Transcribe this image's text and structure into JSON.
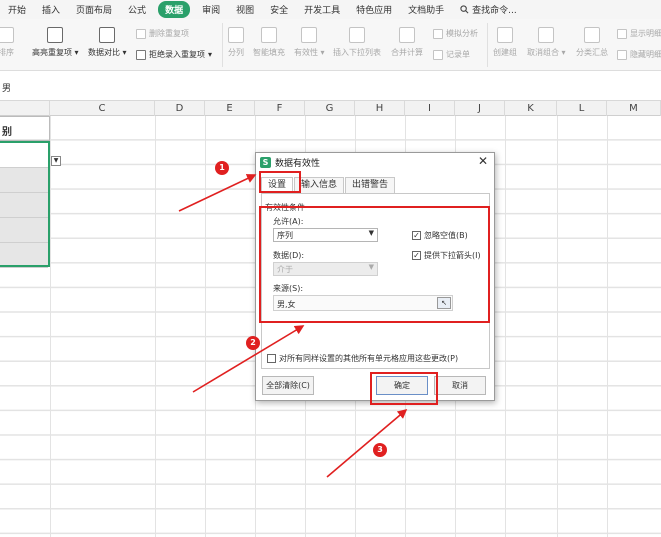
{
  "menubar": {
    "items": [
      "开始",
      "插入",
      "页面布局",
      "公式",
      "数据",
      "审阅",
      "视图",
      "安全",
      "开发工具",
      "特色应用",
      "文档助手"
    ],
    "active": "数据",
    "search": "查找命令..."
  },
  "ribbon": {
    "sort_label": "排序",
    "highlight_dup": "高亮重复项",
    "data_compare": "数据对比",
    "delete_dup": "删除重复项",
    "reject_dup": "拒绝录入重复项",
    "split": "分列",
    "smart_fill": "智能填充",
    "validity": "有效性",
    "insert_dropdown": "插入下拉列表",
    "consolidate": "合并计算",
    "simulate": "模拟分析",
    "record": "记录单",
    "create_group": "创建组",
    "ungroup": "取消组合",
    "subtotal": "分类汇总",
    "show_detail": "显示明细",
    "hide_detail": "隐藏明细"
  },
  "formula_bar": {
    "value": "男"
  },
  "columns": [
    "C",
    "D",
    "E",
    "F",
    "G",
    "H",
    "I",
    "J",
    "K",
    "L",
    "M"
  ],
  "sheet": {
    "b1_text": "别"
  },
  "dialog": {
    "title": "数据有效性",
    "close": "✕",
    "tabs": [
      "设置",
      "输入信息",
      "出错警告"
    ],
    "group_label": "有效性条件",
    "allow_label": "允许(A):",
    "allow_value": "序列",
    "data_label": "数据(D):",
    "data_value": "介于",
    "ignore_blank": "忽略空值(B)",
    "ignore_blank_checked": true,
    "dropdown_arrow": "提供下拉箭头(I)",
    "dropdown_arrow_checked": true,
    "source_label": "来源(S):",
    "source_value": "男,女",
    "apply_all": "对所有同样设置的其他所有单元格应用这些更改(P)",
    "clear_all": "全部清除(C)",
    "ok": "确定",
    "cancel": "取消"
  },
  "annotations": {
    "badge1": "1",
    "badge2": "2",
    "badge3": "3"
  },
  "colors": {
    "accent": "#2aa06a",
    "annotation": "#e02020"
  }
}
